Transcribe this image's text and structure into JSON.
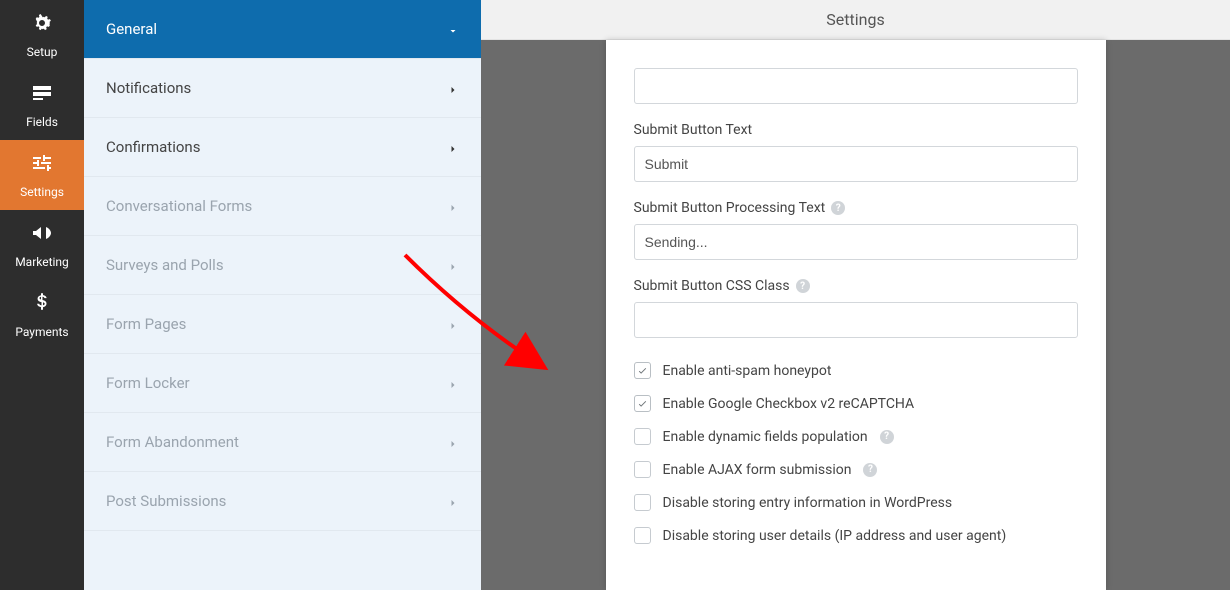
{
  "mainbar": [
    {
      "id": "setup",
      "label": "Setup"
    },
    {
      "id": "fields",
      "label": "Fields"
    },
    {
      "id": "settings",
      "label": "Settings",
      "active": true
    },
    {
      "id": "marketing",
      "label": "Marketing"
    },
    {
      "id": "payments",
      "label": "Payments"
    }
  ],
  "subbar": {
    "items": [
      {
        "id": "general",
        "label": "General",
        "active": true
      },
      {
        "id": "notifications",
        "label": "Notifications"
      },
      {
        "id": "confirmations",
        "label": "Confirmations"
      },
      {
        "id": "conversational",
        "label": "Conversational Forms",
        "muted": true
      },
      {
        "id": "surveys",
        "label": "Surveys and Polls",
        "muted": true
      },
      {
        "id": "formpages",
        "label": "Form Pages",
        "muted": true
      },
      {
        "id": "formlocker",
        "label": "Form Locker",
        "muted": true
      },
      {
        "id": "abandonment",
        "label": "Form Abandonment",
        "muted": true
      },
      {
        "id": "postsub",
        "label": "Post Submissions",
        "muted": true
      }
    ]
  },
  "stage": {
    "title": "Settings"
  },
  "panel": {
    "submit_text_label": "Submit Button Text",
    "submit_text_value": "Submit",
    "processing_label": "Submit Button Processing Text",
    "processing_value": "Sending...",
    "css_class_label": "Submit Button CSS Class",
    "css_class_value": "",
    "checks": [
      {
        "id": "honeypot",
        "label": "Enable anti-spam honeypot",
        "checked": true,
        "help": false
      },
      {
        "id": "recaptcha",
        "label": "Enable Google Checkbox v2 reCAPTCHA",
        "checked": true,
        "help": false
      },
      {
        "id": "dynamic",
        "label": "Enable dynamic fields population",
        "checked": false,
        "help": true
      },
      {
        "id": "ajax",
        "label": "Enable AJAX form submission",
        "checked": false,
        "help": true
      },
      {
        "id": "noentry",
        "label": "Disable storing entry information in WordPress",
        "checked": false,
        "help": false
      },
      {
        "id": "nouser",
        "label": "Disable storing user details (IP address and user agent)",
        "checked": false,
        "help": false
      }
    ]
  }
}
